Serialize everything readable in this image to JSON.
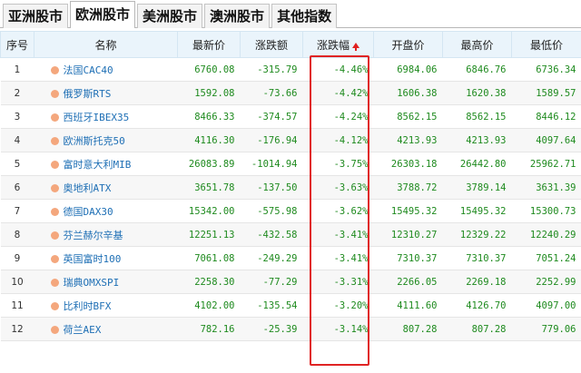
{
  "tabs": [
    "亚洲股市",
    "欧洲股市",
    "美洲股市",
    "澳洲股市",
    "其他指数"
  ],
  "active_tab": 1,
  "columns": [
    "序号",
    "名称",
    "最新价",
    "涨跌额",
    "涨跌幅",
    "开盘价",
    "最高价",
    "最低价"
  ],
  "sorted_column_index": 4,
  "colors": {
    "down": "#1e8a1e",
    "link": "#1e6fb5",
    "highlight": "#e02424",
    "header_bg": "#eaf4fb"
  },
  "rows": [
    {
      "idx": "1",
      "name": "法国CAC40",
      "last": "6760.08",
      "chg": "-315.79",
      "pct": "-4.46%",
      "open": "6984.06",
      "high": "6846.76",
      "low": "6736.34"
    },
    {
      "idx": "2",
      "name": "俄罗斯RTS",
      "last": "1592.08",
      "chg": "-73.66",
      "pct": "-4.42%",
      "open": "1606.38",
      "high": "1620.38",
      "low": "1589.57"
    },
    {
      "idx": "3",
      "name": "西班牙IBEX35",
      "last": "8466.33",
      "chg": "-374.57",
      "pct": "-4.24%",
      "open": "8562.15",
      "high": "8562.15",
      "low": "8446.12"
    },
    {
      "idx": "4",
      "name": "欧洲斯托克50",
      "last": "4116.30",
      "chg": "-176.94",
      "pct": "-4.12%",
      "open": "4213.93",
      "high": "4213.93",
      "low": "4097.64"
    },
    {
      "idx": "5",
      "name": "富时意大利MIB",
      "last": "26083.89",
      "chg": "-1014.94",
      "pct": "-3.75%",
      "open": "26303.18",
      "high": "26442.80",
      "low": "25962.71"
    },
    {
      "idx": "6",
      "name": "奥地利ATX",
      "last": "3651.78",
      "chg": "-137.50",
      "pct": "-3.63%",
      "open": "3788.72",
      "high": "3789.14",
      "low": "3631.39"
    },
    {
      "idx": "7",
      "name": "德国DAX30",
      "last": "15342.00",
      "chg": "-575.98",
      "pct": "-3.62%",
      "open": "15495.32",
      "high": "15495.32",
      "low": "15300.73"
    },
    {
      "idx": "8",
      "name": "芬兰赫尔辛基",
      "last": "12251.13",
      "chg": "-432.58",
      "pct": "-3.41%",
      "open": "12310.27",
      "high": "12329.22",
      "low": "12240.29"
    },
    {
      "idx": "9",
      "name": "英国富时100",
      "last": "7061.08",
      "chg": "-249.29",
      "pct": "-3.41%",
      "open": "7310.37",
      "high": "7310.37",
      "low": "7051.24"
    },
    {
      "idx": "10",
      "name": "瑞典OMXSPI",
      "last": "2258.30",
      "chg": "-77.29",
      "pct": "-3.31%",
      "open": "2266.05",
      "high": "2269.18",
      "low": "2252.99"
    },
    {
      "idx": "11",
      "name": "比利时BFX",
      "last": "4102.00",
      "chg": "-135.54",
      "pct": "-3.20%",
      "open": "4111.60",
      "high": "4126.70",
      "low": "4097.00"
    },
    {
      "idx": "12",
      "name": "荷兰AEX",
      "last": "782.16",
      "chg": "-25.39",
      "pct": "-3.14%",
      "open": "807.28",
      "high": "807.28",
      "low": "779.06"
    }
  ]
}
